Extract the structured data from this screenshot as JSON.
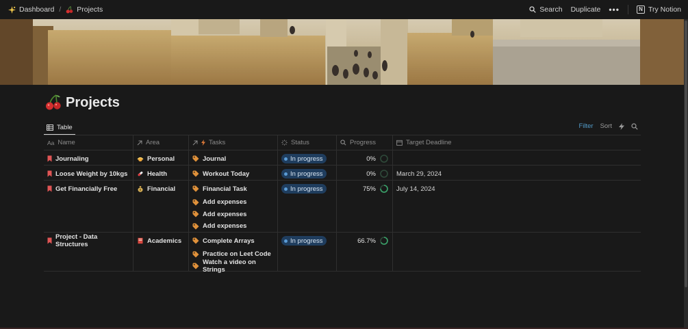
{
  "topbar": {
    "breadcrumb": [
      {
        "label": "Dashboard",
        "icon": "sparkle-icon"
      },
      {
        "label": "Projects",
        "icon": "cherry-icon"
      }
    ],
    "separator": "/",
    "search_label": "Search",
    "duplicate_label": "Duplicate",
    "more_label": "•••",
    "try_label": "Try Notion"
  },
  "page": {
    "title": "Projects",
    "icon": "cherry-icon"
  },
  "view": {
    "tab_label": "Table",
    "filter_label": "Filter",
    "sort_label": "Sort"
  },
  "table": {
    "headers": {
      "name": "Name",
      "name_prefix": "Aa",
      "area": "Area",
      "tasks": "Tasks",
      "status": "Status",
      "progress": "Progress",
      "deadline": "Target Deadline"
    },
    "rows": [
      {
        "name": "Journaling",
        "area": "Personal",
        "area_icon": "sun-icon",
        "tasks": [
          "Journal"
        ],
        "status": "In progress",
        "progress": "0%",
        "progress_value": 0,
        "deadline": ""
      },
      {
        "name": "Loose Weight by 10kgs",
        "area": "Health",
        "area_icon": "pill-icon",
        "tasks": [
          "Workout Today"
        ],
        "status": "In progress",
        "progress": "0%",
        "progress_value": 0,
        "deadline": "March 29, 2024"
      },
      {
        "name": "Get Financially Free",
        "area": "Financial",
        "area_icon": "money-bag-icon",
        "tasks": [
          "Financial Task",
          "Add expenses",
          "Add expenses",
          "Add expenses"
        ],
        "status": "In progress",
        "progress": "75%",
        "progress_value": 0.75,
        "deadline": "July 14, 2024"
      },
      {
        "name": "Project - Data Structures",
        "area": "Academics",
        "area_icon": "book-icon",
        "tasks": [
          "Complete Arrays",
          "Practice on Leet Code",
          "Watch a video on Strings"
        ],
        "status": "In progress",
        "progress": "66.7%",
        "progress_value": 0.667,
        "deadline": ""
      }
    ]
  },
  "colors": {
    "status_pill": "#1f3d5e",
    "progress_ring": "#3aa36a",
    "bookmark": "#e05555",
    "tag": "#e0913a",
    "filter": "#529cca"
  }
}
